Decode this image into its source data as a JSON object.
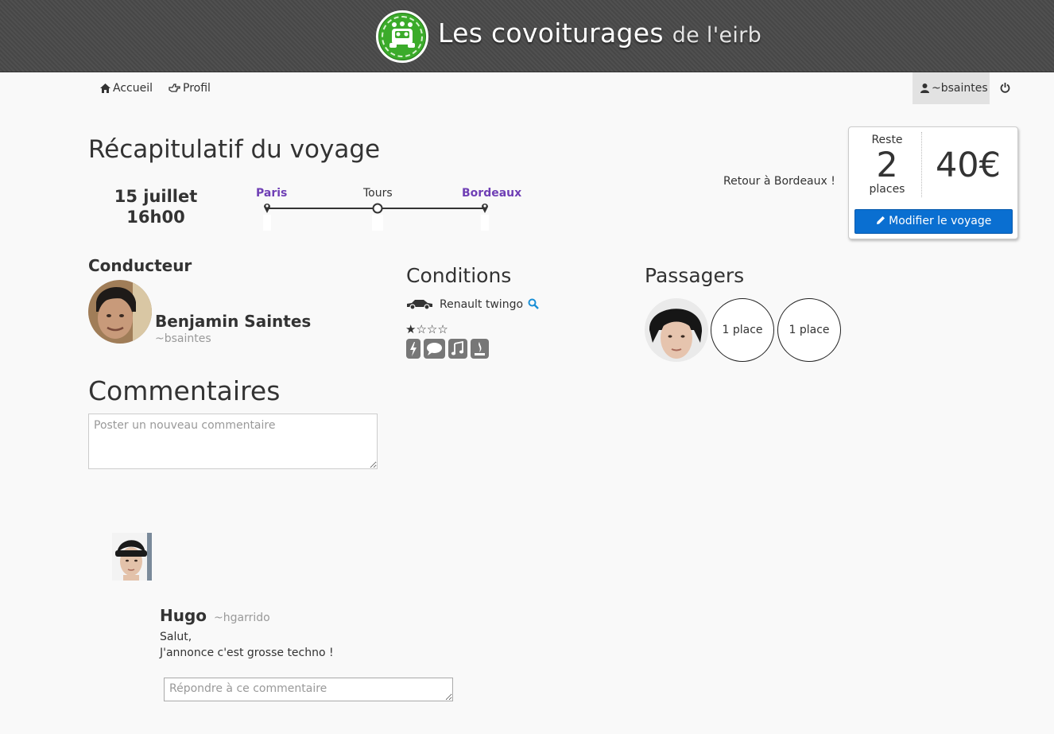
{
  "header": {
    "title_main": "Les covoiturages",
    "title_sub": "de l'eirb",
    "logo_icon": "car-logo-icon",
    "brand_color": "#3bab2a"
  },
  "nav": {
    "home_label": "Accueil",
    "home_icon": "home-icon",
    "profile_label": "Profil",
    "profile_icon": "hand-point-icon",
    "user_label": "~bsaintes",
    "user_icon": "user-icon",
    "logout_icon": "power-icon"
  },
  "trip": {
    "title": "Récapitulatif du voyage",
    "date": "15 juillet",
    "time": "16h00",
    "stops": [
      {
        "name": "Paris",
        "type": "endpoint"
      },
      {
        "name": "Tours",
        "type": "step"
      },
      {
        "name": "Bordeaux",
        "type": "endpoint"
      }
    ],
    "note": "Retour à Bordeaux !",
    "endpoint_color": "#6f3fb5"
  },
  "summary": {
    "remaining_label": "Reste",
    "remaining_count": "2",
    "remaining_unit": "places",
    "price": "40€",
    "modify_label": "Modifier le voyage",
    "modify_icon": "pencil-icon",
    "button_color": "#0a6fd1"
  },
  "driver": {
    "heading": "Conducteur",
    "name": "Benjamin Saintes",
    "username": "~bsaintes"
  },
  "conditions": {
    "heading": "Conditions",
    "car_icon": "car-icon",
    "car_model": "Renault twingo",
    "search_icon": "search-icon",
    "rating": 1,
    "rating_max": 5,
    "stars_text": "★☆☆☆",
    "icons": [
      "bolt-icon",
      "speech-bubble-icon",
      "music-icon",
      "no-smoking-icon"
    ]
  },
  "passengers": {
    "heading": "Passagers",
    "free_seat_labels": [
      "1 place",
      "1 place"
    ]
  },
  "comments": {
    "heading": "Commentaires",
    "new_placeholder": "Poster un nouveau commentaire",
    "items": [
      {
        "author": "Hugo",
        "username": "~hgarrido",
        "lines": [
          "Salut,",
          "J'annonce c'est grosse techno !"
        ],
        "reply_placeholder": "Répondre à ce commentaire"
      }
    ]
  }
}
